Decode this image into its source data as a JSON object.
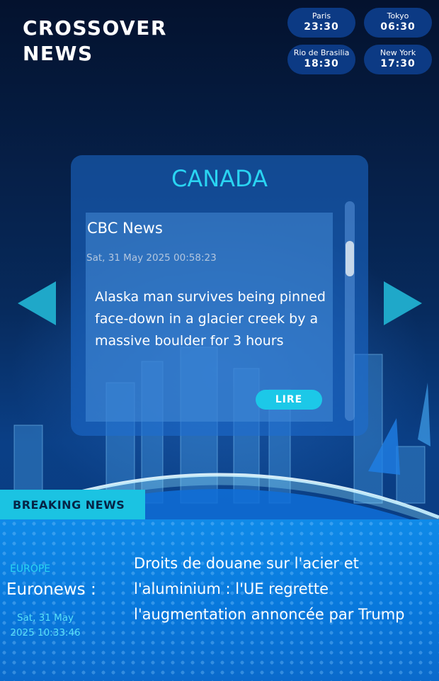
{
  "app": {
    "title_line1": "CROSSOVER",
    "title_line2": "NEWS"
  },
  "clocks": [
    {
      "city": "Paris",
      "time": "23:30"
    },
    {
      "city": "Tokyo",
      "time": "06:30"
    },
    {
      "city": "Rio de Brasilia",
      "time": "18:30"
    },
    {
      "city": "New York",
      "time": "17:30"
    }
  ],
  "card": {
    "region": "CANADA",
    "source": "CBC News",
    "date": "Sat, 31 May 2025 00:58:23",
    "headline": "Alaska man survives being pinned face-down in a glacier creek by a massive boulder for 3 hours",
    "read_label": "LIRE"
  },
  "nav": {
    "prev_icon": "triangle-left-icon",
    "next_icon": "triangle-right-icon"
  },
  "breaking": {
    "tab_label": "BREAKING NEWS",
    "region": "EUROPE",
    "source": "Euronews :",
    "date": "Sat, 31 May 2025 10:33:46",
    "headline": "Droits de douane sur l'acier et l'aluminium : l'UE regrette l'augmentation annoncée par Trump"
  },
  "colors": {
    "accent": "#1bc3e2",
    "card": "#1e6ed2",
    "panel": "#0a80e0"
  }
}
